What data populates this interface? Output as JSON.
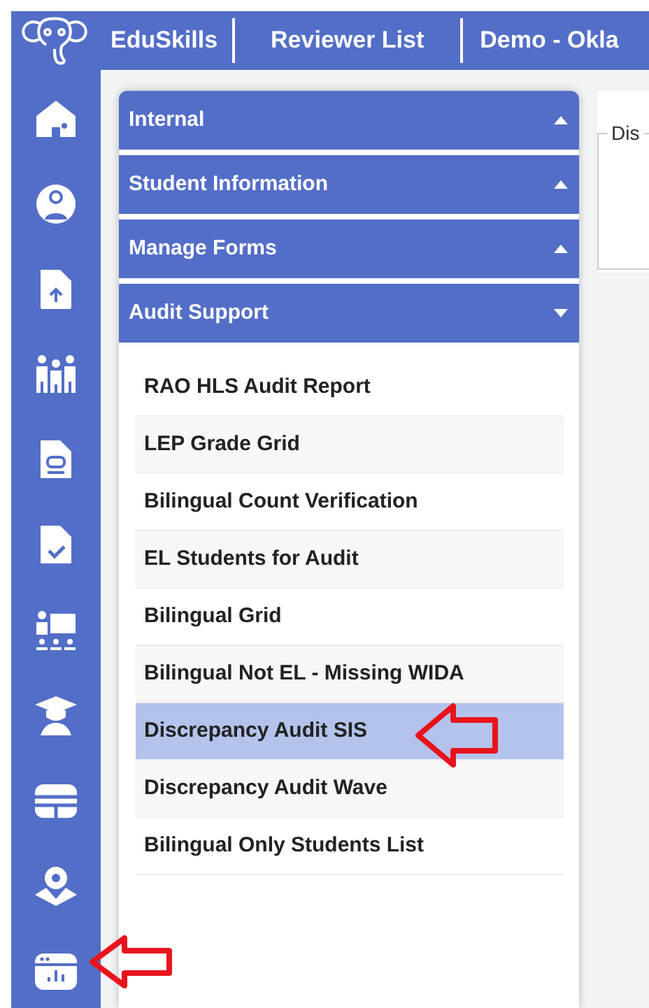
{
  "navbar": {
    "brand": "EduSkills",
    "links": [
      "Reviewer List",
      "Demo - Okla"
    ]
  },
  "accordion": [
    {
      "title": "Internal",
      "expanded": false
    },
    {
      "title": "Student Information",
      "expanded": false
    },
    {
      "title": "Manage Forms",
      "expanded": false
    },
    {
      "title": "Audit Support",
      "expanded": true,
      "items": [
        {
          "label": "RAO HLS Audit Report",
          "selected": false
        },
        {
          "label": "LEP Grade Grid",
          "selected": false
        },
        {
          "label": "Bilingual Count Verification",
          "selected": false
        },
        {
          "label": "EL Students for Audit",
          "selected": false
        },
        {
          "label": "Bilingual Grid",
          "selected": false
        },
        {
          "label": "Bilingual Not EL - Missing WIDA",
          "selected": false
        },
        {
          "label": "Discrepancy Audit SIS",
          "selected": true
        },
        {
          "label": "Discrepancy Audit Wave",
          "selected": false
        },
        {
          "label": "Bilingual Only Students List",
          "selected": false
        }
      ]
    }
  ],
  "detail": {
    "legend": "Dis"
  }
}
